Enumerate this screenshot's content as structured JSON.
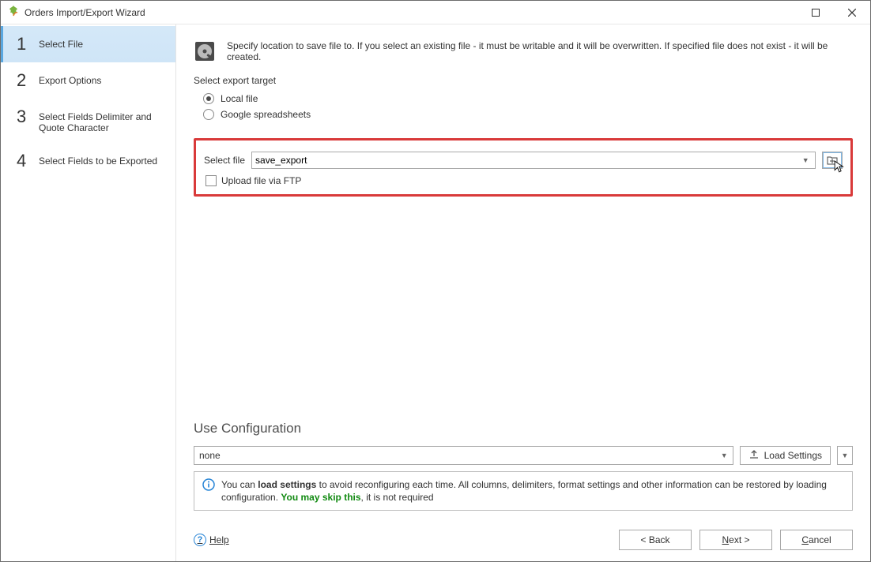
{
  "window": {
    "title": "Orders Import/Export Wizard"
  },
  "steps": [
    {
      "num": "1",
      "label": "Select File",
      "selected": true
    },
    {
      "num": "2",
      "label": "Export Options"
    },
    {
      "num": "3",
      "label": "Select Fields Delimiter and Quote Character"
    },
    {
      "num": "4",
      "label": "Select Fields to be Exported"
    }
  ],
  "intro": "Specify location to save file to. If you select an existing file - it must be writable and it will be overwritten. If specified file does not exist - it will be created.",
  "target_label": "Select export target",
  "radios": {
    "local": "Local file",
    "google": "Google spreadsheets",
    "selected": "local"
  },
  "file_label": "Select file",
  "file_value": "save_export",
  "ftp_label": "Upload file via FTP",
  "config": {
    "title": "Use Configuration",
    "value": "none",
    "load_label": "Load Settings",
    "info_prefix": "You can ",
    "info_bold": "load settings",
    "info_mid": " to avoid reconfiguring each time. All columns, delimiters, format settings and other information can be restored by loading configuration. ",
    "info_skip": "You may skip this",
    "info_tail": ", it is not required"
  },
  "help": "Help",
  "buttons": {
    "back": "< Back",
    "next_pre": "N",
    "next_rest": "ext >",
    "cancel_pre": "C",
    "cancel_rest": "ancel"
  }
}
